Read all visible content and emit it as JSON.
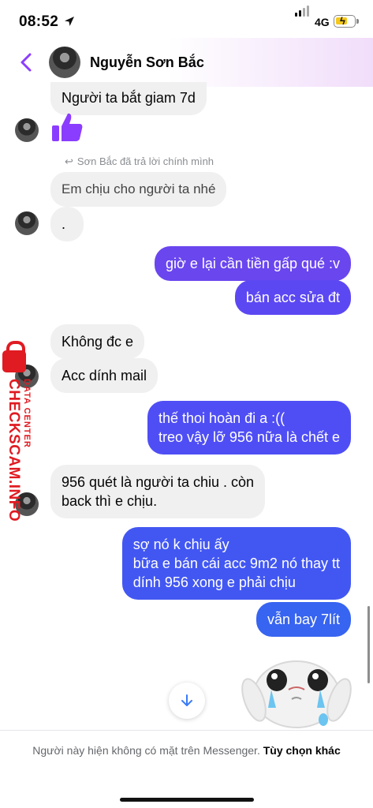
{
  "status_bar": {
    "time": "08:52",
    "network": "4G"
  },
  "header": {
    "contact_name": "Nguyễn Sơn Bắc"
  },
  "messages": {
    "m1": "Người ta bắt giam 7d",
    "reply_note": "Sơn Bắc đã trả lời chính mình",
    "m2": "Em chịu cho người ta nhé",
    "m3": ".",
    "m4": "giờ e lại cần tiền gấp qué :v",
    "m5": "bán acc sửa đt",
    "m6": "Không đc e",
    "m7": "Acc dính mail",
    "m8": "thế thoi hoàn đi a :((\ntreo vậy lỡ 956 nữa là chết e",
    "m9": "956 quét là người ta chiu . còn\nback thì e chịu.",
    "m10": "sợ nó k chịu ấy\nbữa e bán cái acc 9m2 nó thay tt\ndính 956 xong e phải chịu",
    "m11": "vẫn bay 7lít"
  },
  "watermark": {
    "main": "CHECKSCAM.INFO",
    "sub": "DATA CENTER"
  },
  "footer": {
    "notice": "Người này hiện không có mặt trên Messenger.",
    "action": "Tùy chọn khác"
  },
  "colors": {
    "accent": "#8b3dff",
    "outgoing": "#5b4bf5",
    "incoming": "#f0f0f0",
    "watermark": "#e01b22"
  }
}
